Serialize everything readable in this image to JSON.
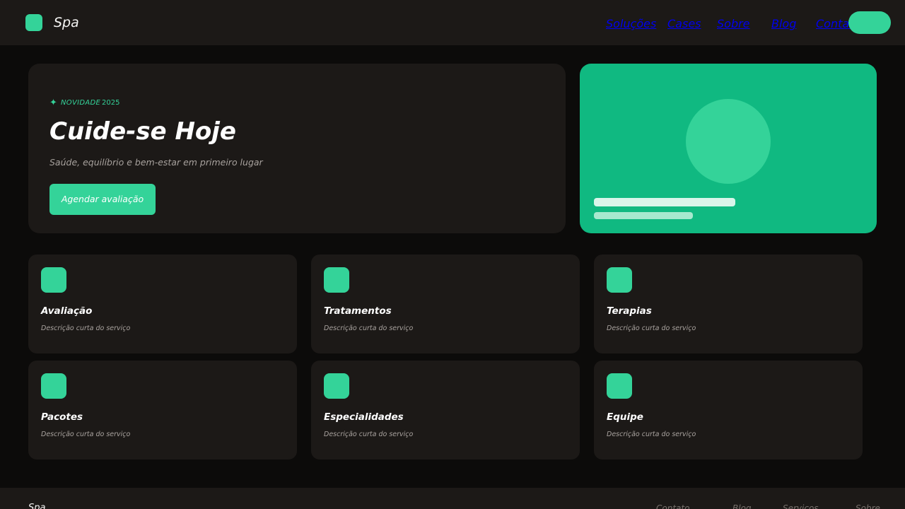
{
  "header": {
    "brand": "Spa",
    "nav": [
      "Soluções",
      "Cases",
      "Sobre",
      "Blog",
      "Contato"
    ]
  },
  "hero": {
    "badge_label": "NOVIDADE",
    "badge_year": "2025",
    "title": "Cuide-se Hoje",
    "subtitle": "Saúde, equilíbrio e bem-estar em primeiro lugar",
    "cta": "Agendar avaliação"
  },
  "services": [
    {
      "title": "Avaliação",
      "desc": "Descrição curta do serviço"
    },
    {
      "title": "Tratamentos",
      "desc": "Descrição curta do serviço"
    },
    {
      "title": "Terapias",
      "desc": "Descrição curta do serviço"
    },
    {
      "title": "Pacotes",
      "desc": "Descrição curta do serviço"
    },
    {
      "title": "Especialidades",
      "desc": "Descrição curta do serviço"
    },
    {
      "title": "Equipe",
      "desc": "Descrição curta do serviço"
    }
  ],
  "footer": {
    "brand": "Spa",
    "links": [
      "Contato",
      "Blog",
      "Serviços",
      "Sobre"
    ]
  },
  "colors": {
    "accent": "#34d399",
    "accent_dark": "#10b981",
    "surface": "#1c1917",
    "background": "#0c0b0a"
  }
}
